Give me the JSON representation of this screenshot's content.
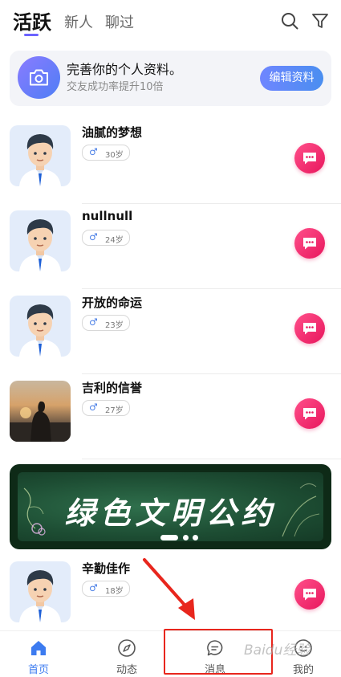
{
  "top_tabs": [
    {
      "label": "活跃",
      "active": true
    },
    {
      "label": "新人",
      "active": false
    },
    {
      "label": "聊过",
      "active": false
    }
  ],
  "top_icons": [
    "search-icon",
    "filter-icon"
  ],
  "profile_card": {
    "title": "完善你的个人资料。",
    "subtitle": "交友成功率提升10倍",
    "button": "编辑资料",
    "icon": "camera-icon"
  },
  "users": [
    {
      "name": "油腻的梦想",
      "gender": "♂",
      "age": "30岁",
      "avatar": "cartoon-man"
    },
    {
      "name": "nullnull",
      "gender": "♂",
      "age": "24岁",
      "avatar": "cartoon-man"
    },
    {
      "name": "开放的命运",
      "gender": "♂",
      "age": "23岁",
      "avatar": "cartoon-man"
    },
    {
      "name": "吉利的信誉",
      "gender": "♂",
      "age": "27岁",
      "avatar": "sunset-photo"
    }
  ],
  "banner": {
    "text": "绿色文明公约",
    "pages": 3,
    "current_page": 1
  },
  "users_after_banner": [
    {
      "name": "辛勤佳作",
      "gender": "♂",
      "age": "18岁",
      "avatar": "cartoon-man"
    }
  ],
  "bottom_nav": [
    {
      "label": "首页",
      "icon": "home-icon",
      "active": true
    },
    {
      "label": "动态",
      "icon": "compass-icon",
      "active": false
    },
    {
      "label": "消息",
      "icon": "message-icon",
      "active": false
    },
    {
      "label": "我的",
      "icon": "profile-icon",
      "active": false
    }
  ],
  "annotation": {
    "highlighted_item": "消息",
    "color": "#e8261d"
  },
  "watermark": "Baidu经验",
  "colors": {
    "accent": "#4a8ef0",
    "chat": "#e8175d",
    "tab_underline": "#6c63ff"
  }
}
